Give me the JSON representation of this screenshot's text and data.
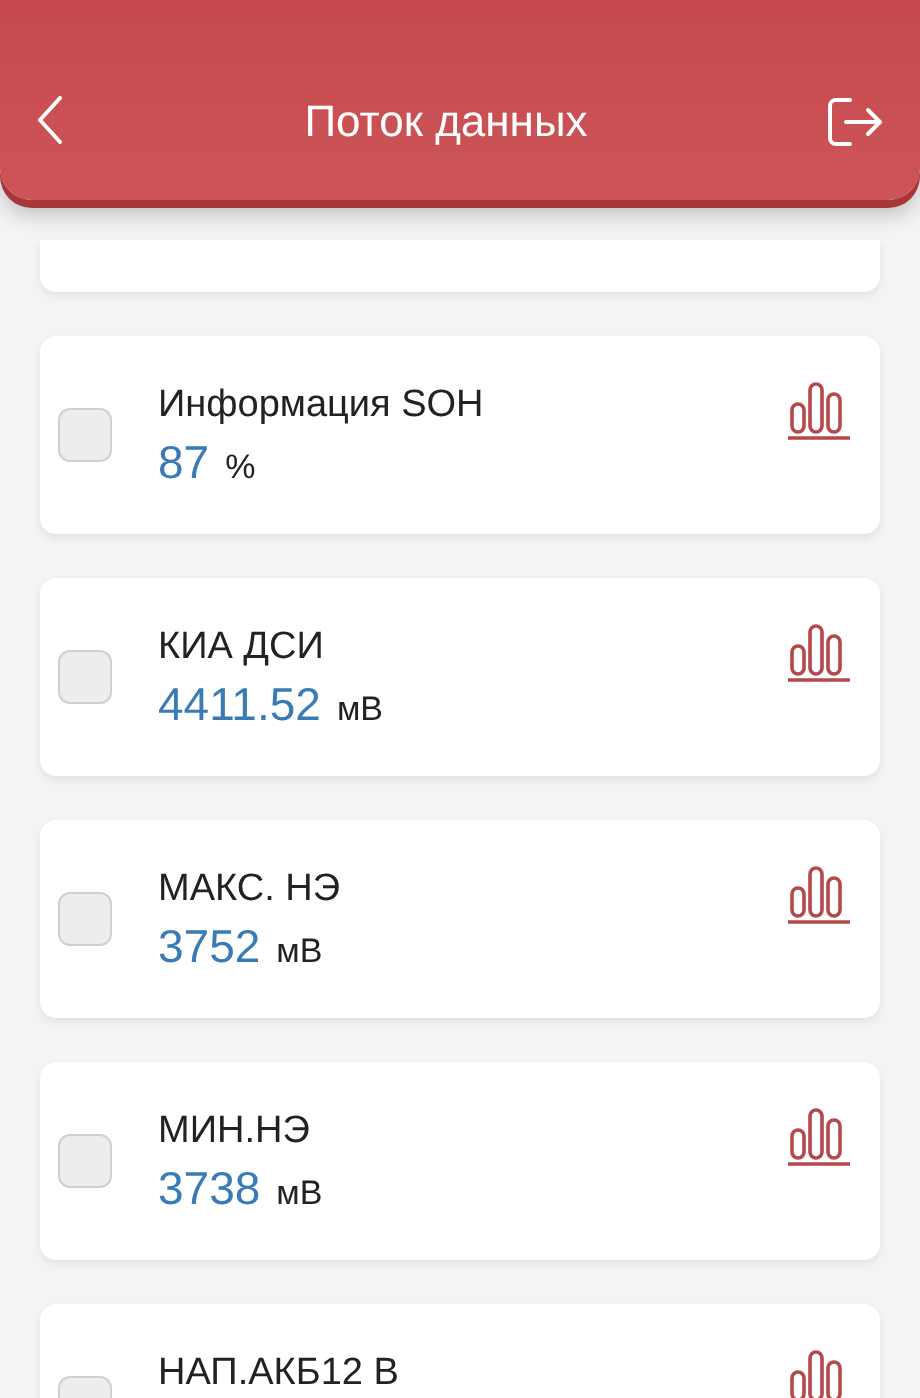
{
  "header": {
    "title": "Поток данных"
  },
  "items": [
    {
      "name": "Информация SOH",
      "value": "87",
      "unit": "%",
      "checked": false
    },
    {
      "name": "КИА ДСИ",
      "value": "4411.52",
      "unit": "мВ",
      "checked": false
    },
    {
      "name": "МАКС. НЭ",
      "value": "3752",
      "unit": "мВ",
      "checked": false
    },
    {
      "name": "МИН.НЭ",
      "value": "3738",
      "unit": "мВ",
      "checked": false
    },
    {
      "name": "НАП.АКБ12 В",
      "checked": false
    }
  ]
}
